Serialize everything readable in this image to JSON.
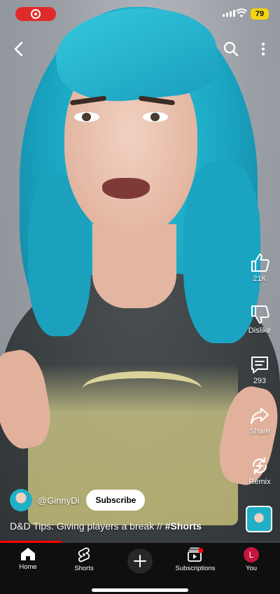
{
  "status_bar": {
    "battery": "79"
  },
  "top_bar": {
    "back_icon": "chevron-left-icon",
    "search_icon": "search-icon",
    "more_icon": "more-vertical-icon"
  },
  "actions": {
    "like": {
      "label": "21K",
      "icon": "thumbs-up-icon"
    },
    "dislike": {
      "label": "Dislike",
      "icon": "thumbs-down-icon"
    },
    "comments": {
      "label": "293",
      "icon": "comment-icon"
    },
    "share": {
      "label": "Share",
      "icon": "share-icon"
    },
    "remix": {
      "label": "Remix",
      "icon": "remix-icon"
    }
  },
  "video": {
    "channel": "@GinnyDi",
    "subscribe_label": "Subscribe",
    "title": "D&D Tips: Giving players a break // ",
    "hashtag": "#Shorts",
    "progress": 0.22
  },
  "nav": {
    "home": "Home",
    "shorts": "Shorts",
    "subscriptions": "Subscriptions",
    "you": "You",
    "you_initial": "L"
  },
  "colors": {
    "accent": "#ff0000",
    "battery": "#f5d40f",
    "record": "#e02a2a"
  }
}
